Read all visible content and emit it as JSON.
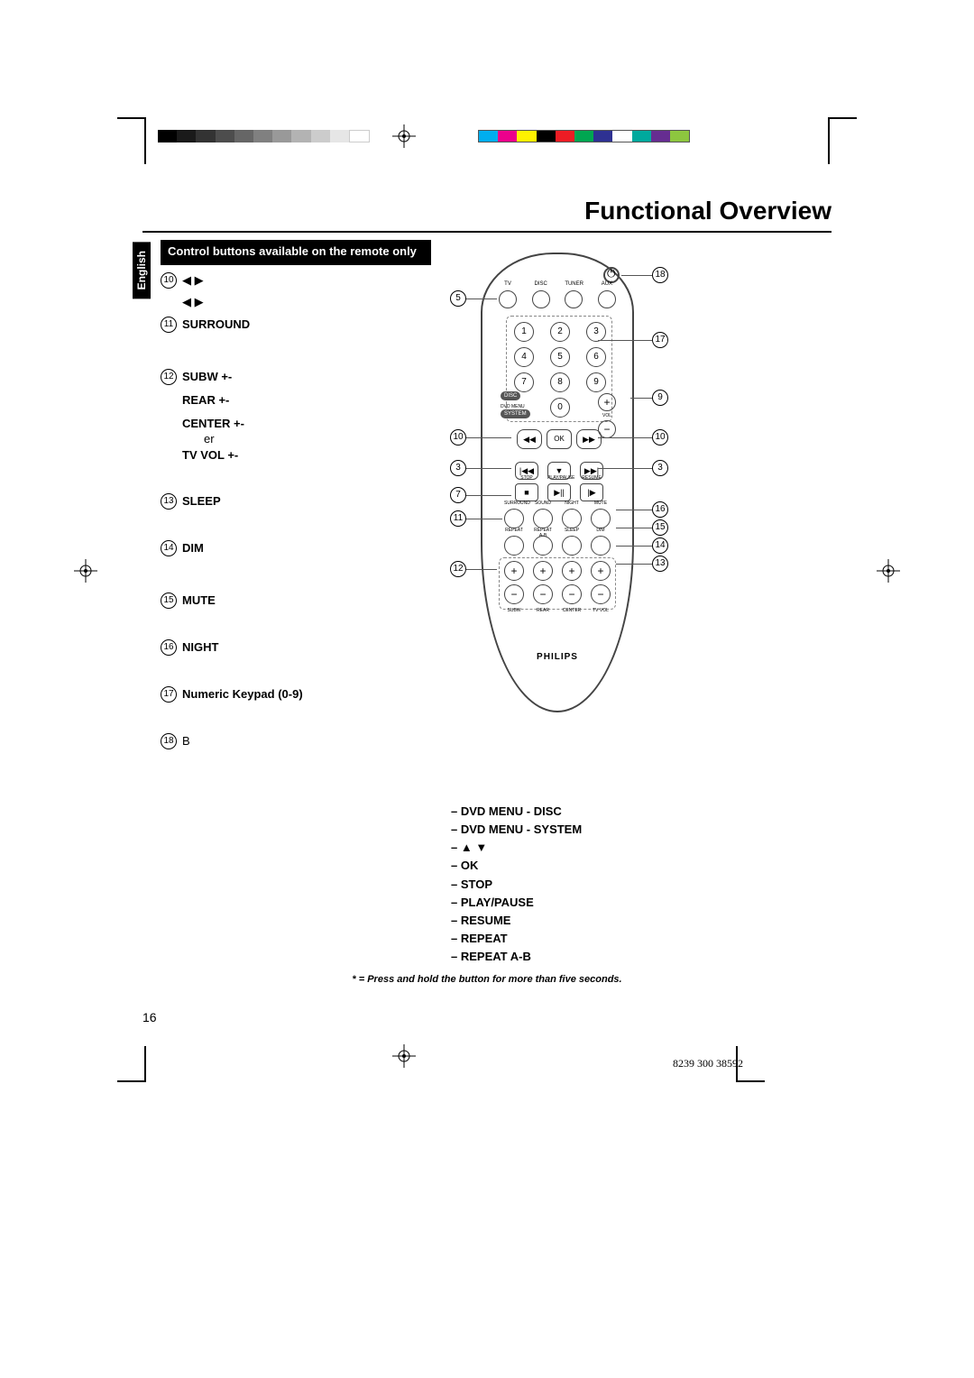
{
  "heading": "Functional Overview",
  "language_tab": "English",
  "section_header": "Control buttons available on the remote only",
  "items": {
    "i10": {
      "num": "10",
      "label": "◀ ▶",
      "sub": "◀ ▶"
    },
    "i11": {
      "num": "11",
      "label": "SURROUND"
    },
    "i12": {
      "num": "12",
      "subw": "SUBW +-",
      "rear": "REAR +-",
      "center": "CENTER +-",
      "center_sub": "er",
      "tvvol": "TV VOL +-"
    },
    "i13": {
      "num": "13",
      "label": "SLEEP"
    },
    "i14": {
      "num": "14",
      "label": "DIM"
    },
    "i15": {
      "num": "15",
      "label": "MUTE"
    },
    "i16": {
      "num": "16",
      "label": "NIGHT"
    },
    "i17": {
      "num": "17",
      "label": "Numeric Keypad (0-9)"
    },
    "i18": {
      "num": "18",
      "label": "B"
    }
  },
  "bullets": [
    "DVD MENU - DISC",
    "DVD MENU - SYSTEM",
    "▲ ▼",
    "OK",
    "STOP",
    "PLAY/PAUSE",
    "RESUME",
    "REPEAT",
    "REPEAT A-B"
  ],
  "footnote": "* = Press and hold the button for more than five seconds.",
  "page_number": "16",
  "doc_id": "8239 300 38592",
  "remote": {
    "brand": "PHILIPS",
    "sources": [
      "TV",
      "DISC",
      "TUNER",
      "AUX"
    ],
    "keypad": [
      "1",
      "2",
      "3",
      "4",
      "5",
      "6",
      "7",
      "8",
      "9",
      "0"
    ],
    "disc_label": "DISC",
    "dvd_menu_label": "DVD MENU",
    "system_label": "SYSTEM",
    "ok_label": "OK",
    "vol_label": "VOL",
    "play_labels": [
      "STOP",
      "PLAY/PAUSE",
      "RESUME"
    ],
    "fn_labels_1": [
      "SURROUND",
      "SOUND",
      "NIGHT",
      "MUTE"
    ],
    "fn_labels_2": [
      "REPEAT",
      "REPEAT A-B",
      "SLEEP",
      "DIM"
    ],
    "pm_labels": [
      "SUBW",
      "REAR",
      "CENTER",
      "TV VOL"
    ]
  },
  "callouts_left": [
    "5",
    "10",
    "3",
    "7",
    "11",
    "12"
  ],
  "callouts_right": [
    "18",
    "17",
    "9",
    "10",
    "3",
    "16",
    "15",
    "14",
    "13"
  ]
}
